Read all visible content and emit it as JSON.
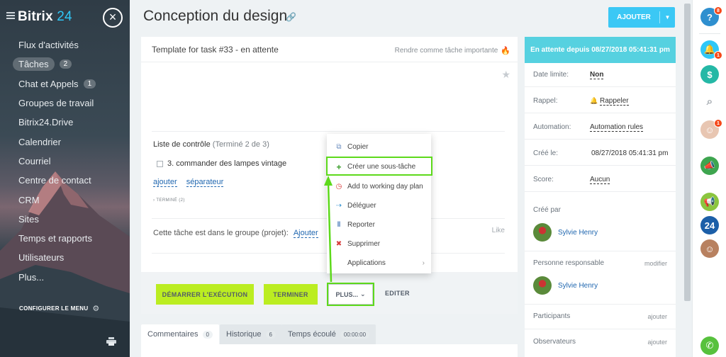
{
  "sidebar": {
    "logo_main": "Bitrix",
    "logo_num": "24",
    "items": [
      {
        "label": "Flux d'activités",
        "badge": ""
      },
      {
        "label": "Tâches",
        "badge": "2"
      },
      {
        "label": "Chat et Appels",
        "badge": "1"
      },
      {
        "label": "Groupes de travail",
        "badge": ""
      },
      {
        "label": "Bitrix24.Drive",
        "badge": ""
      },
      {
        "label": "Calendrier",
        "badge": ""
      },
      {
        "label": "Courriel",
        "badge": ""
      },
      {
        "label": "Centre de contact",
        "badge": ""
      },
      {
        "label": "CRM",
        "badge": ""
      },
      {
        "label": "Sites",
        "badge": ""
      },
      {
        "label": "Temps et rapports",
        "badge": ""
      },
      {
        "label": "Utilisateurs",
        "badge": ""
      },
      {
        "label": "Plus...",
        "badge": ""
      }
    ],
    "config_label": "CONFIGURER LE MENU"
  },
  "header": {
    "title": "Conception du design",
    "add_label": "AJOUTER"
  },
  "task": {
    "subtitle": "Template for task #33 - en attente",
    "important_label": "Rendre comme tâche importante",
    "checklist_title": "Liste de contrôle",
    "checklist_count": "(Terminé 2 de 3)",
    "checklist_item": "3. commander des lampes vintage",
    "add_link": "ajouter",
    "separator_link": "séparateur",
    "done_label": "› TERMINÉ (2)",
    "group_label": "Cette tâche est dans le groupe (projet):",
    "group_add": "Ajouter",
    "like_label": "Like",
    "buttons": {
      "start": "DÉMARRER L'EXÉCUTION",
      "finish": "TERMINER",
      "more": "PLUS...",
      "edit": "EDITER"
    }
  },
  "popup_menu": [
    {
      "icon": "copy-icon",
      "label": "Copier"
    },
    {
      "icon": "plus-icon",
      "label": "Créer une sous-tâche"
    },
    {
      "icon": "clock-icon",
      "label": "Add to working day plan"
    },
    {
      "icon": "delegate-icon",
      "label": "Déléguer"
    },
    {
      "icon": "pause-icon",
      "label": "Reporter"
    },
    {
      "icon": "delete-icon",
      "label": "Supprimer"
    },
    {
      "icon": "chevron-right-icon",
      "label": "Applications"
    }
  ],
  "tabs": [
    {
      "label": "Commentaires",
      "count": "0"
    },
    {
      "label": "Historique",
      "count": "6"
    },
    {
      "label": "Temps écoulé",
      "count": "00:00:00"
    }
  ],
  "status": {
    "header": "En attente depuis 08/27/2018 05:41:31 pm",
    "rows": [
      {
        "label": "Date limite:",
        "value": "Non"
      },
      {
        "label": "Rappel:",
        "value": "Rappeler"
      },
      {
        "label": "Automation:",
        "value": "Automation rules"
      },
      {
        "label": "Créé le:",
        "value": "08/27/2018 05:41:31 pm"
      },
      {
        "label": "Score:",
        "value": "Aucun"
      }
    ],
    "created_by_label": "Créé par",
    "created_by_name": "Sylvie Henry",
    "responsible_label": "Personne responsable",
    "responsible_action": "modifier",
    "responsible_name": "Sylvie Henry",
    "participants_label": "Participants",
    "participants_action": "ajouter",
    "observers_label": "Observateurs",
    "observers_action": "ajouter"
  },
  "right_bar": {
    "help_badge": "8",
    "notif_badge": "1",
    "people_badge": "1",
    "b24_label": "24"
  },
  "colors": {
    "accent_blue": "#3bc8f5",
    "button_green": "#bbed21",
    "highlight_green": "#5dd91b",
    "status_cyan": "#56d1e0"
  }
}
